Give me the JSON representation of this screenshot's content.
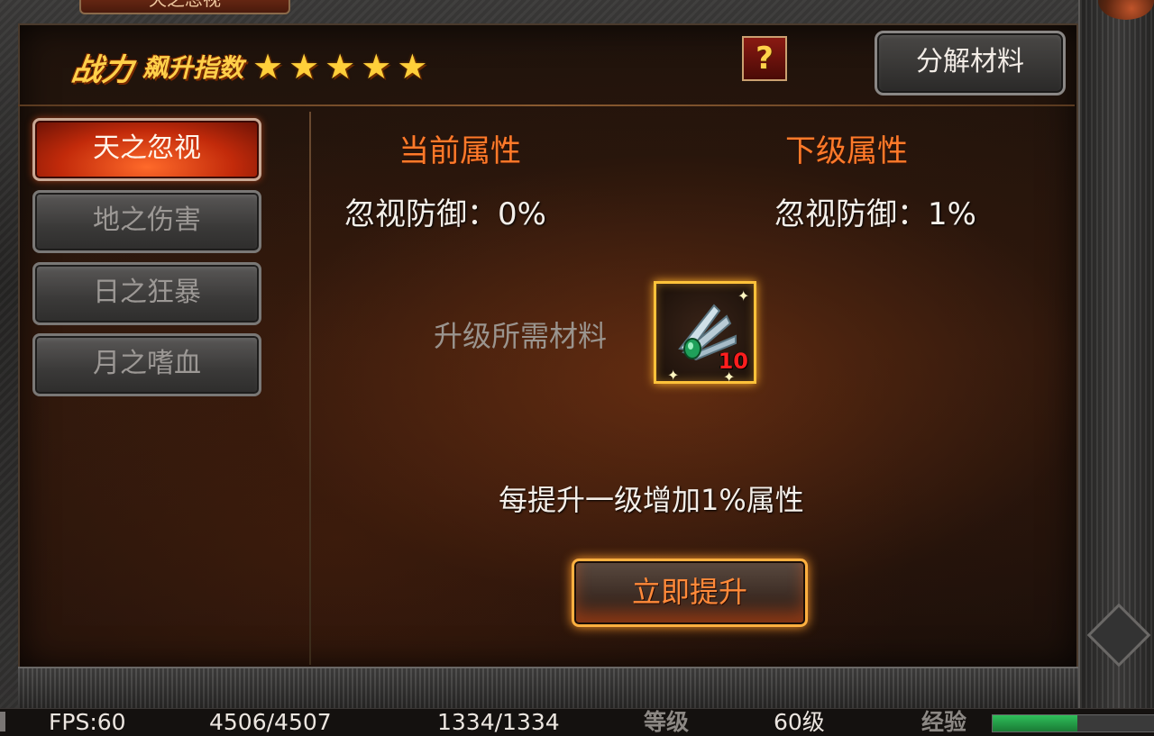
{
  "window": {
    "title_tab": "天之忽视"
  },
  "header": {
    "title_big": "战力",
    "title_sub": "飙升指数",
    "star_count": 5,
    "help_label": "?",
    "decompose_label": "分解材料"
  },
  "tabs": [
    {
      "label": "天之忽视",
      "active": true
    },
    {
      "label": "地之伤害",
      "active": false
    },
    {
      "label": "日之狂暴",
      "active": false
    },
    {
      "label": "月之嗜血",
      "active": false
    }
  ],
  "current": {
    "heading": "当前属性",
    "value": "忽视防御：0%"
  },
  "next": {
    "heading": "下级属性",
    "value": "忽视防御：1%"
  },
  "material": {
    "label": "升级所需材料",
    "item_icon": "claw-fragment-icon",
    "count": "10"
  },
  "info_text": "每提升一级增加1%属性",
  "upgrade_label": "立即提升",
  "status": {
    "fps": "FPS:60",
    "hp": "4506/4507",
    "mp": "1334/1334",
    "level_label": "等级",
    "level_value": "60级",
    "exp_label": "经验",
    "exp_fraction": 0.52
  },
  "colors": {
    "accent_orange": "#ff7a2a",
    "gold": "#ffd04a",
    "active_tab": "#c22a0a",
    "exp_green": "#2fbf5a",
    "item_count": "#ff1e1e"
  }
}
